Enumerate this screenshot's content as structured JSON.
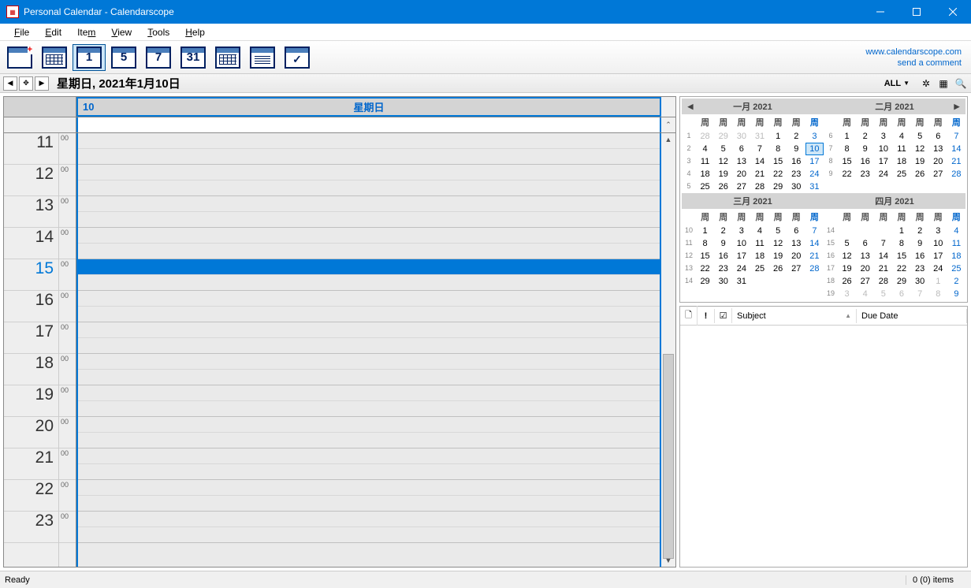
{
  "window": {
    "title": "Personal Calendar - Calendarscope"
  },
  "menu": {
    "file": "File",
    "edit": "Edit",
    "item": "Item",
    "view": "View",
    "tools": "Tools",
    "help": "Help"
  },
  "toolbar": {
    "btn1": "1",
    "btn5": "5",
    "btn7": "7",
    "btn31": "31",
    "link1": "www.calendarscope.com",
    "link2": "send a comment"
  },
  "navbar": {
    "date": "星期日, 2021年1月10日",
    "all": "ALL"
  },
  "dayview": {
    "daynum": "10",
    "dayname": "星期日",
    "hours": [
      "11",
      "12",
      "13",
      "14",
      "15",
      "16",
      "17",
      "18",
      "19",
      "20",
      "21",
      "22",
      "23"
    ],
    "min": "00",
    "selected_hour_index": 4
  },
  "minicals": [
    {
      "title": "一月 2021",
      "nav": "left",
      "wk": [
        "1",
        "2",
        "3",
        "4",
        "5"
      ],
      "dh": [
        "周",
        "周",
        "周",
        "周",
        "周",
        "周",
        "周"
      ],
      "rows": [
        [
          "28",
          "29",
          "30",
          "31",
          "1",
          "2",
          "3"
        ],
        [
          "4",
          "5",
          "6",
          "7",
          "8",
          "9",
          "10"
        ],
        [
          "11",
          "12",
          "13",
          "14",
          "15",
          "16",
          "17"
        ],
        [
          "18",
          "19",
          "20",
          "21",
          "22",
          "23",
          "24"
        ],
        [
          "25",
          "26",
          "27",
          "28",
          "29",
          "30",
          "31"
        ]
      ],
      "today": [
        1,
        6
      ],
      "other_before": 4
    },
    {
      "title": "二月 2021",
      "nav": "right",
      "wk": [
        "6",
        "7",
        "8",
        "9"
      ],
      "dh": [
        "周",
        "周",
        "周",
        "周",
        "周",
        "周",
        "周"
      ],
      "rows": [
        [
          "1",
          "2",
          "3",
          "4",
          "5",
          "6",
          "7"
        ],
        [
          "8",
          "9",
          "10",
          "11",
          "12",
          "13",
          "14"
        ],
        [
          "15",
          "16",
          "17",
          "18",
          "19",
          "20",
          "21"
        ],
        [
          "22",
          "23",
          "24",
          "25",
          "26",
          "27",
          "28"
        ],
        [
          "",
          "",
          "",
          "",
          "",
          "",
          ""
        ]
      ]
    },
    {
      "title": "三月 2021",
      "wk": [
        "10",
        "11",
        "12",
        "13",
        "14"
      ],
      "dh": [
        "周",
        "周",
        "周",
        "周",
        "周",
        "周",
        "周"
      ],
      "rows": [
        [
          "1",
          "2",
          "3",
          "4",
          "5",
          "6",
          "7"
        ],
        [
          "8",
          "9",
          "10",
          "11",
          "12",
          "13",
          "14"
        ],
        [
          "15",
          "16",
          "17",
          "18",
          "19",
          "20",
          "21"
        ],
        [
          "22",
          "23",
          "24",
          "25",
          "26",
          "27",
          "28"
        ],
        [
          "29",
          "30",
          "31",
          "",
          "",
          "",
          ""
        ]
      ]
    },
    {
      "title": "四月 2021",
      "wk": [
        "14",
        "15",
        "16",
        "17",
        "18",
        "19"
      ],
      "dh": [
        "周",
        "周",
        "周",
        "周",
        "周",
        "周",
        "周"
      ],
      "rows": [
        [
          "",
          "",
          "",
          "1",
          "2",
          "3",
          "4"
        ],
        [
          "5",
          "6",
          "7",
          "8",
          "9",
          "10",
          "11"
        ],
        [
          "12",
          "13",
          "14",
          "15",
          "16",
          "17",
          "18"
        ],
        [
          "19",
          "20",
          "21",
          "22",
          "23",
          "24",
          "25"
        ],
        [
          "26",
          "27",
          "28",
          "29",
          "30",
          "1",
          "2"
        ],
        [
          "3",
          "4",
          "5",
          "6",
          "7",
          "8",
          "9"
        ]
      ],
      "other_after_row": 4,
      "other_after_col": 5
    }
  ],
  "tasks": {
    "col_subject": "Subject",
    "col_due": "Due Date"
  },
  "status": {
    "left": "Ready",
    "right": "0 (0) items"
  }
}
